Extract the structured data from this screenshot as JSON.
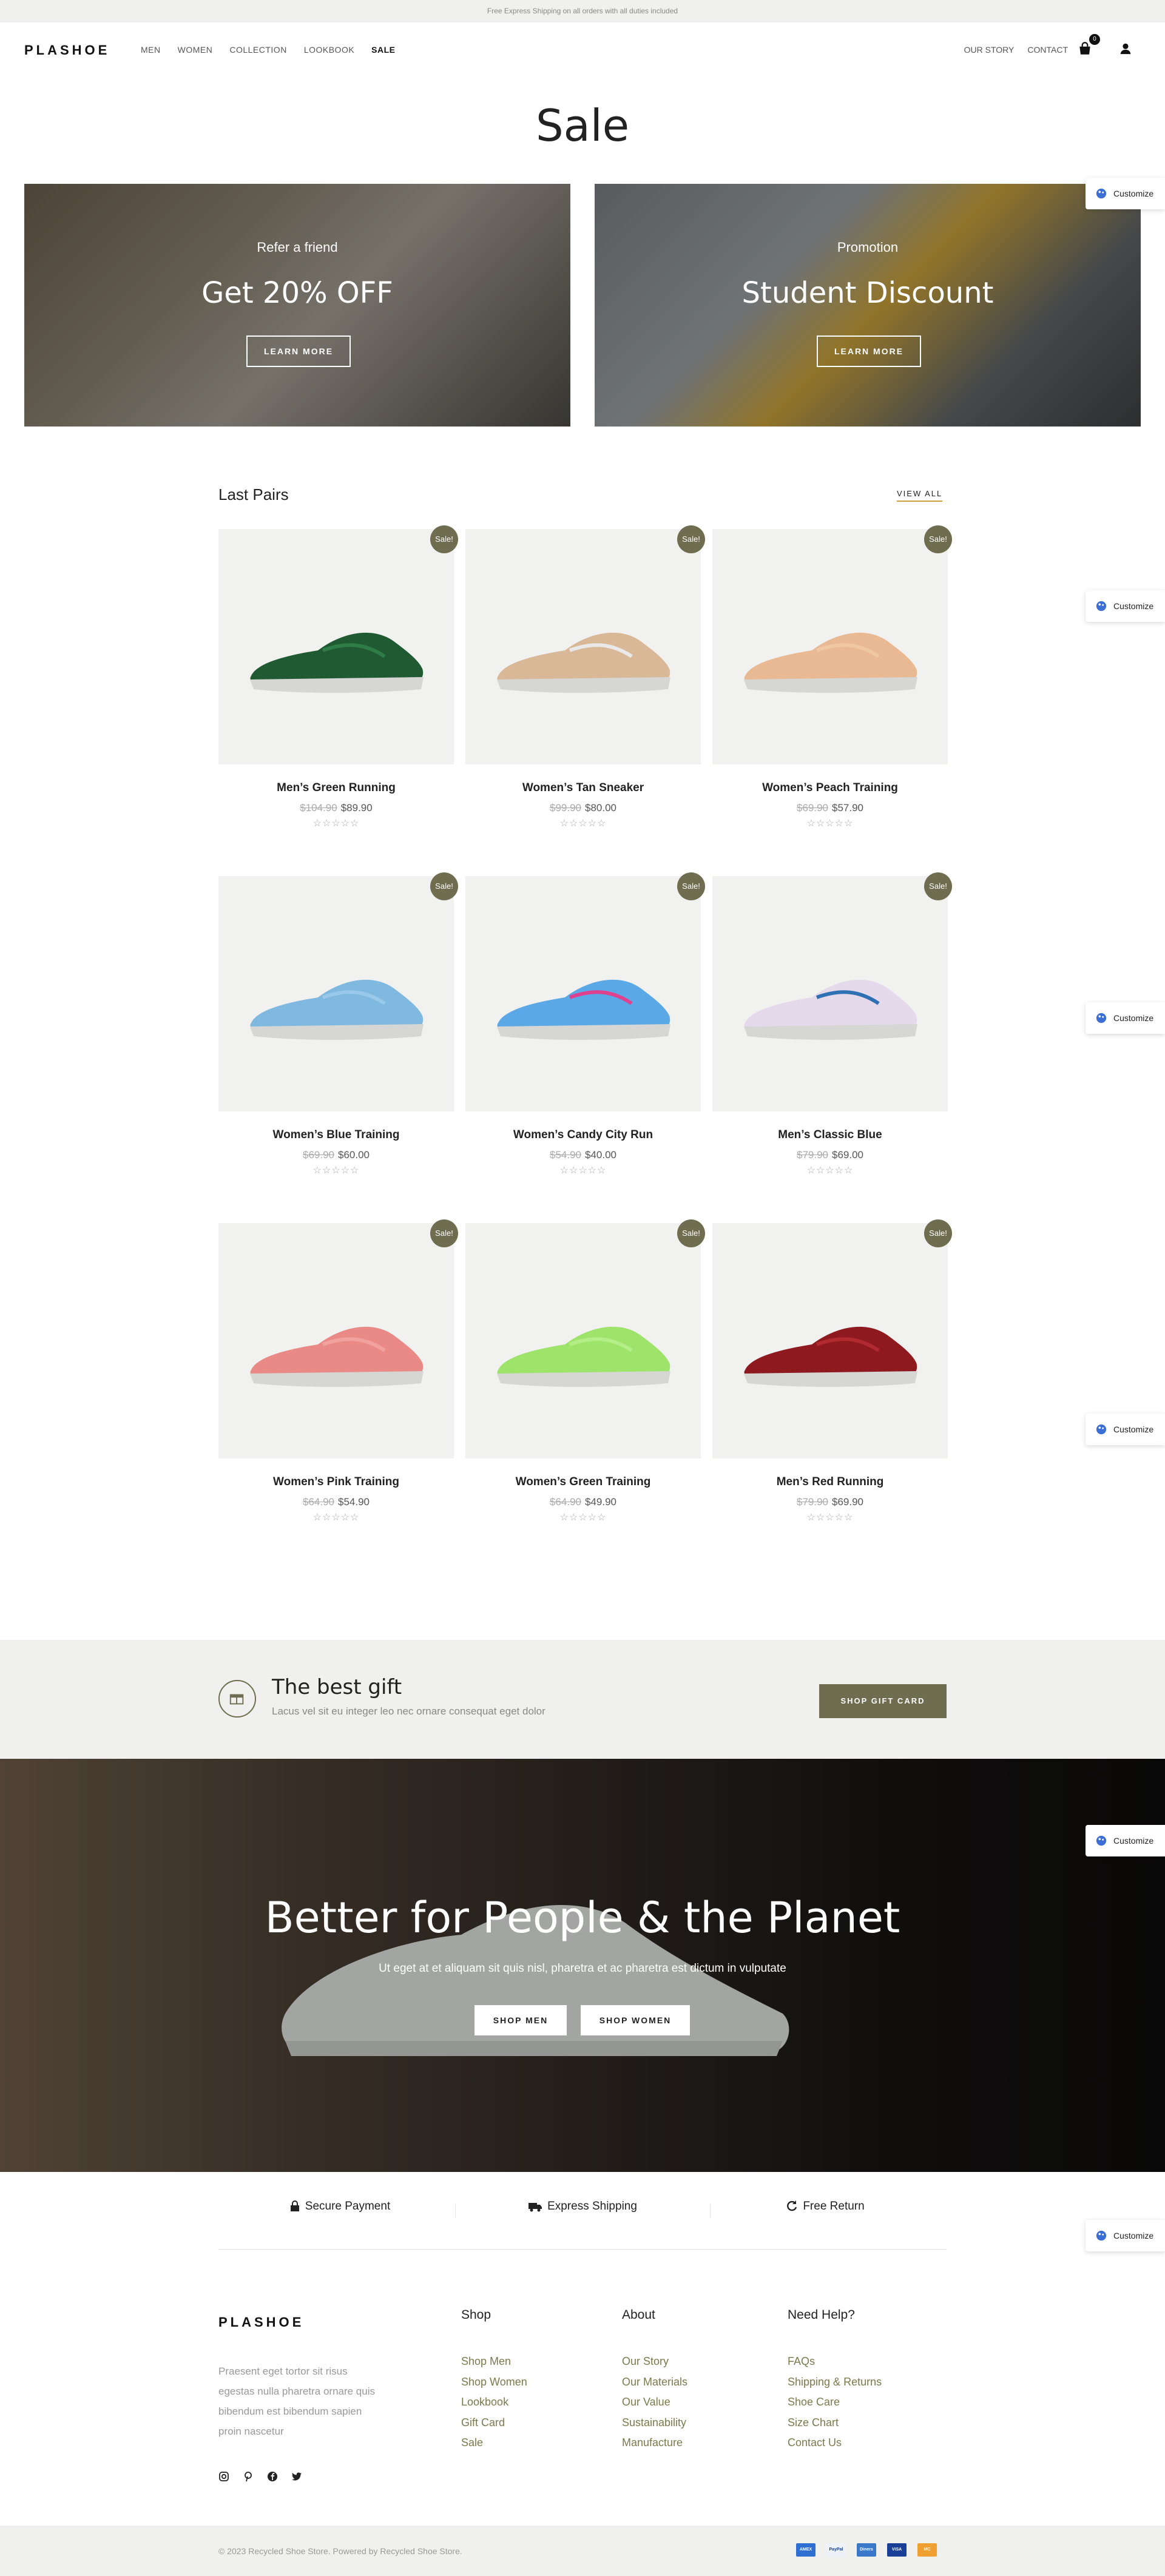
{
  "topbar": {
    "text": "Free Express Shipping on all orders with all duties included"
  },
  "header": {
    "logo": "PLASHOE",
    "nav": [
      "MEN",
      "WOMEN",
      "COLLECTION",
      "LOOKBOOK",
      "SALE"
    ],
    "nav_right": [
      "OUR STORY",
      "CONTACT"
    ],
    "cart_count": "0"
  },
  "page_title": "Sale",
  "promos": [
    {
      "kicker": "Refer a friend",
      "headline": "Get 20% OFF",
      "button": "LEARN MORE"
    },
    {
      "kicker": "Promotion",
      "headline": "Student Discount",
      "button": "LEARN MORE"
    }
  ],
  "customize_label": "Customize",
  "last_pairs": {
    "title": "Last Pairs",
    "view_all": "VIEW ALL",
    "sale_badge": "Sale!",
    "stars": "☆☆☆☆☆",
    "products": [
      {
        "name": "Men’s Green Running",
        "old_price": "$104.90",
        "price": "$89.90",
        "color": "#1f5a32",
        "accent": "#2e7d46"
      },
      {
        "name": "Women’s Tan Sneaker",
        "old_price": "$99.90",
        "price": "$80.00",
        "color": "#d8b896",
        "accent": "#e9e9e9"
      },
      {
        "name": "Women’s Peach Training",
        "old_price": "$69.90",
        "price": "$57.90",
        "color": "#e9b993",
        "accent": "#f0c7a3"
      },
      {
        "name": "Women’s Blue Training",
        "old_price": "$69.90",
        "price": "$60.00",
        "color": "#7fb9e0",
        "accent": "#98c9ea"
      },
      {
        "name": "Women’s Candy City Run",
        "old_price": "$54.90",
        "price": "$40.00",
        "color": "#5aa8e6",
        "accent": "#e0418f"
      },
      {
        "name": "Men’s Classic Blue",
        "old_price": "$79.90",
        "price": "$69.00",
        "color": "#e5d9ec",
        "accent": "#2f6fb3"
      },
      {
        "name": "Women’s Pink Training",
        "old_price": "$64.90",
        "price": "$54.90",
        "color": "#e98a86",
        "accent": "#f2a29e"
      },
      {
        "name": "Women’s Green Training",
        "old_price": "$64.90",
        "price": "$49.90",
        "color": "#9ee36a",
        "accent": "#b4ee86"
      },
      {
        "name": "Men’s Red Running",
        "old_price": "$79.90",
        "price": "$69.90",
        "color": "#8e1a20",
        "accent": "#b02a30"
      }
    ]
  },
  "gift": {
    "title": "The best gift",
    "subtitle": "Lacus vel sit eu integer leo nec ornare consequat eget dolor",
    "button": "SHOP GIFT CARD"
  },
  "hero": {
    "title": "Better for People & the Planet",
    "subtitle": "Ut eget at et aliquam sit quis nisl, pharetra et ac pharetra est dictum in vulputate",
    "buttons": [
      "SHOP MEN",
      "SHOP WOMEN"
    ]
  },
  "features": [
    "Secure Payment",
    "Express Shipping",
    "Free Return"
  ],
  "footer": {
    "logo": "PLASHOE",
    "description": "Praesent eget tortor sit risus egestas nulla pharetra ornare quis bibendum est bibendum sapien proin nascetur",
    "columns": [
      {
        "title": "Shop",
        "links": [
          "Shop Men",
          "Shop Women",
          "Lookbook",
          "Gift Card",
          "Sale"
        ]
      },
      {
        "title": "About",
        "links": [
          "Our Story",
          "Our Materials",
          "Our Value",
          "Sustainability",
          "Manufacture"
        ]
      },
      {
        "title": "Need Help?",
        "links": [
          "FAQs",
          "Shipping & Returns",
          "Shoe Care",
          "Size Chart",
          "Contact Us"
        ]
      }
    ],
    "copyright": "© 2023 Recycled Shoe Store. Powered by Recycled Shoe Store.",
    "payment_cards": [
      "AMEX",
      "PayPal",
      "Diners",
      "VISA",
      "MC"
    ]
  }
}
